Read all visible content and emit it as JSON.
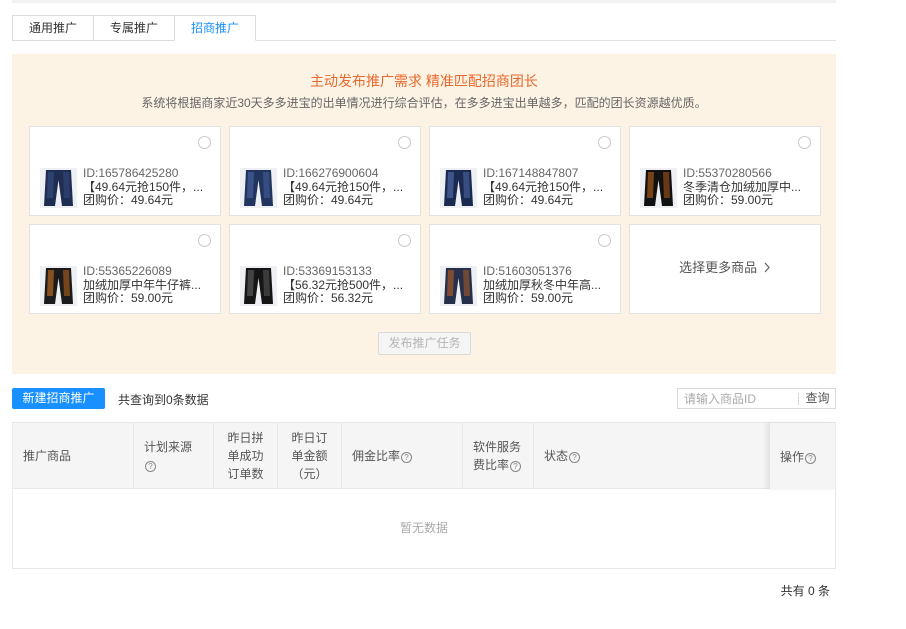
{
  "tabs": [
    {
      "label": "通用推广"
    },
    {
      "label": "专属推广"
    },
    {
      "label": "招商推广"
    }
  ],
  "promo": {
    "title": "主动发布推广需求 精准匹配招商团长",
    "description": "系统将根据商家近30天多多进宝的出单情况进行综合评估，在多多进宝出单越多，匹配的团长资源越优质。",
    "products": [
      {
        "id": "ID:165786425280",
        "name": "【49.64元抢150件，...",
        "price": "团购价：49.64元",
        "thumb_colors": [
          "#1f2d52",
          "#3a5389"
        ]
      },
      {
        "id": "ID:166276900604",
        "name": "【49.64元抢150件，...",
        "price": "团购价：49.64元",
        "thumb_colors": [
          "#22355f",
          "#4e6aa8"
        ]
      },
      {
        "id": "ID:167148847807",
        "name": "【49.64元抢150件，...",
        "price": "团购价：49.64元",
        "thumb_colors": [
          "#1a2a50",
          "#5b79b8"
        ]
      },
      {
        "id": "ID:55370280566",
        "name": "冬季清仓加绒加厚中...",
        "price": "团购价：59.00元",
        "thumb_colors": [
          "#111111",
          "#d06a1c"
        ]
      },
      {
        "id": "ID:55365226089",
        "name": "加绒加厚中年牛仔裤...",
        "price": "团购价：59.00元",
        "thumb_colors": [
          "#1b1b1b",
          "#e07a22"
        ]
      },
      {
        "id": "ID:53369153133",
        "name": "【56.32元抢500件，...",
        "price": "团购价：56.32元",
        "thumb_colors": [
          "#151515",
          "#6a6a6a"
        ]
      },
      {
        "id": "ID:51603051376",
        "name": "加绒加厚秋冬中年高...",
        "price": "团购价：59.00元",
        "thumb_colors": [
          "#26304a",
          "#c9651f"
        ]
      }
    ],
    "more_label": "选择更多商品",
    "publish_label": "发布推广任务"
  },
  "toolbar": {
    "new_button": "新建招商推广",
    "result_text": "共查询到0条数据",
    "search_placeholder": "请输入商品ID",
    "search_button": "查询"
  },
  "table": {
    "columns": [
      "推广商品",
      "计划来源",
      "昨日拼单成功订单数",
      "昨日订单金额（元）",
      "佣金比率",
      "软件服务费比率",
      "状态",
      "操作"
    ],
    "col_lines": {
      "source": "计划来源",
      "orders": [
        "昨日拼",
        "单成功",
        "订单数"
      ],
      "amount": [
        "昨日订",
        "单金额",
        "（元）"
      ],
      "fee": [
        "软件服务",
        "费比率"
      ]
    },
    "empty_text": "暂无数据"
  },
  "pagination": {
    "total_text": "共有 0 条"
  },
  "colors": {
    "accent": "#1890ff",
    "promo_bg": "#fdf3e4",
    "promo_title": "#e8692d"
  }
}
